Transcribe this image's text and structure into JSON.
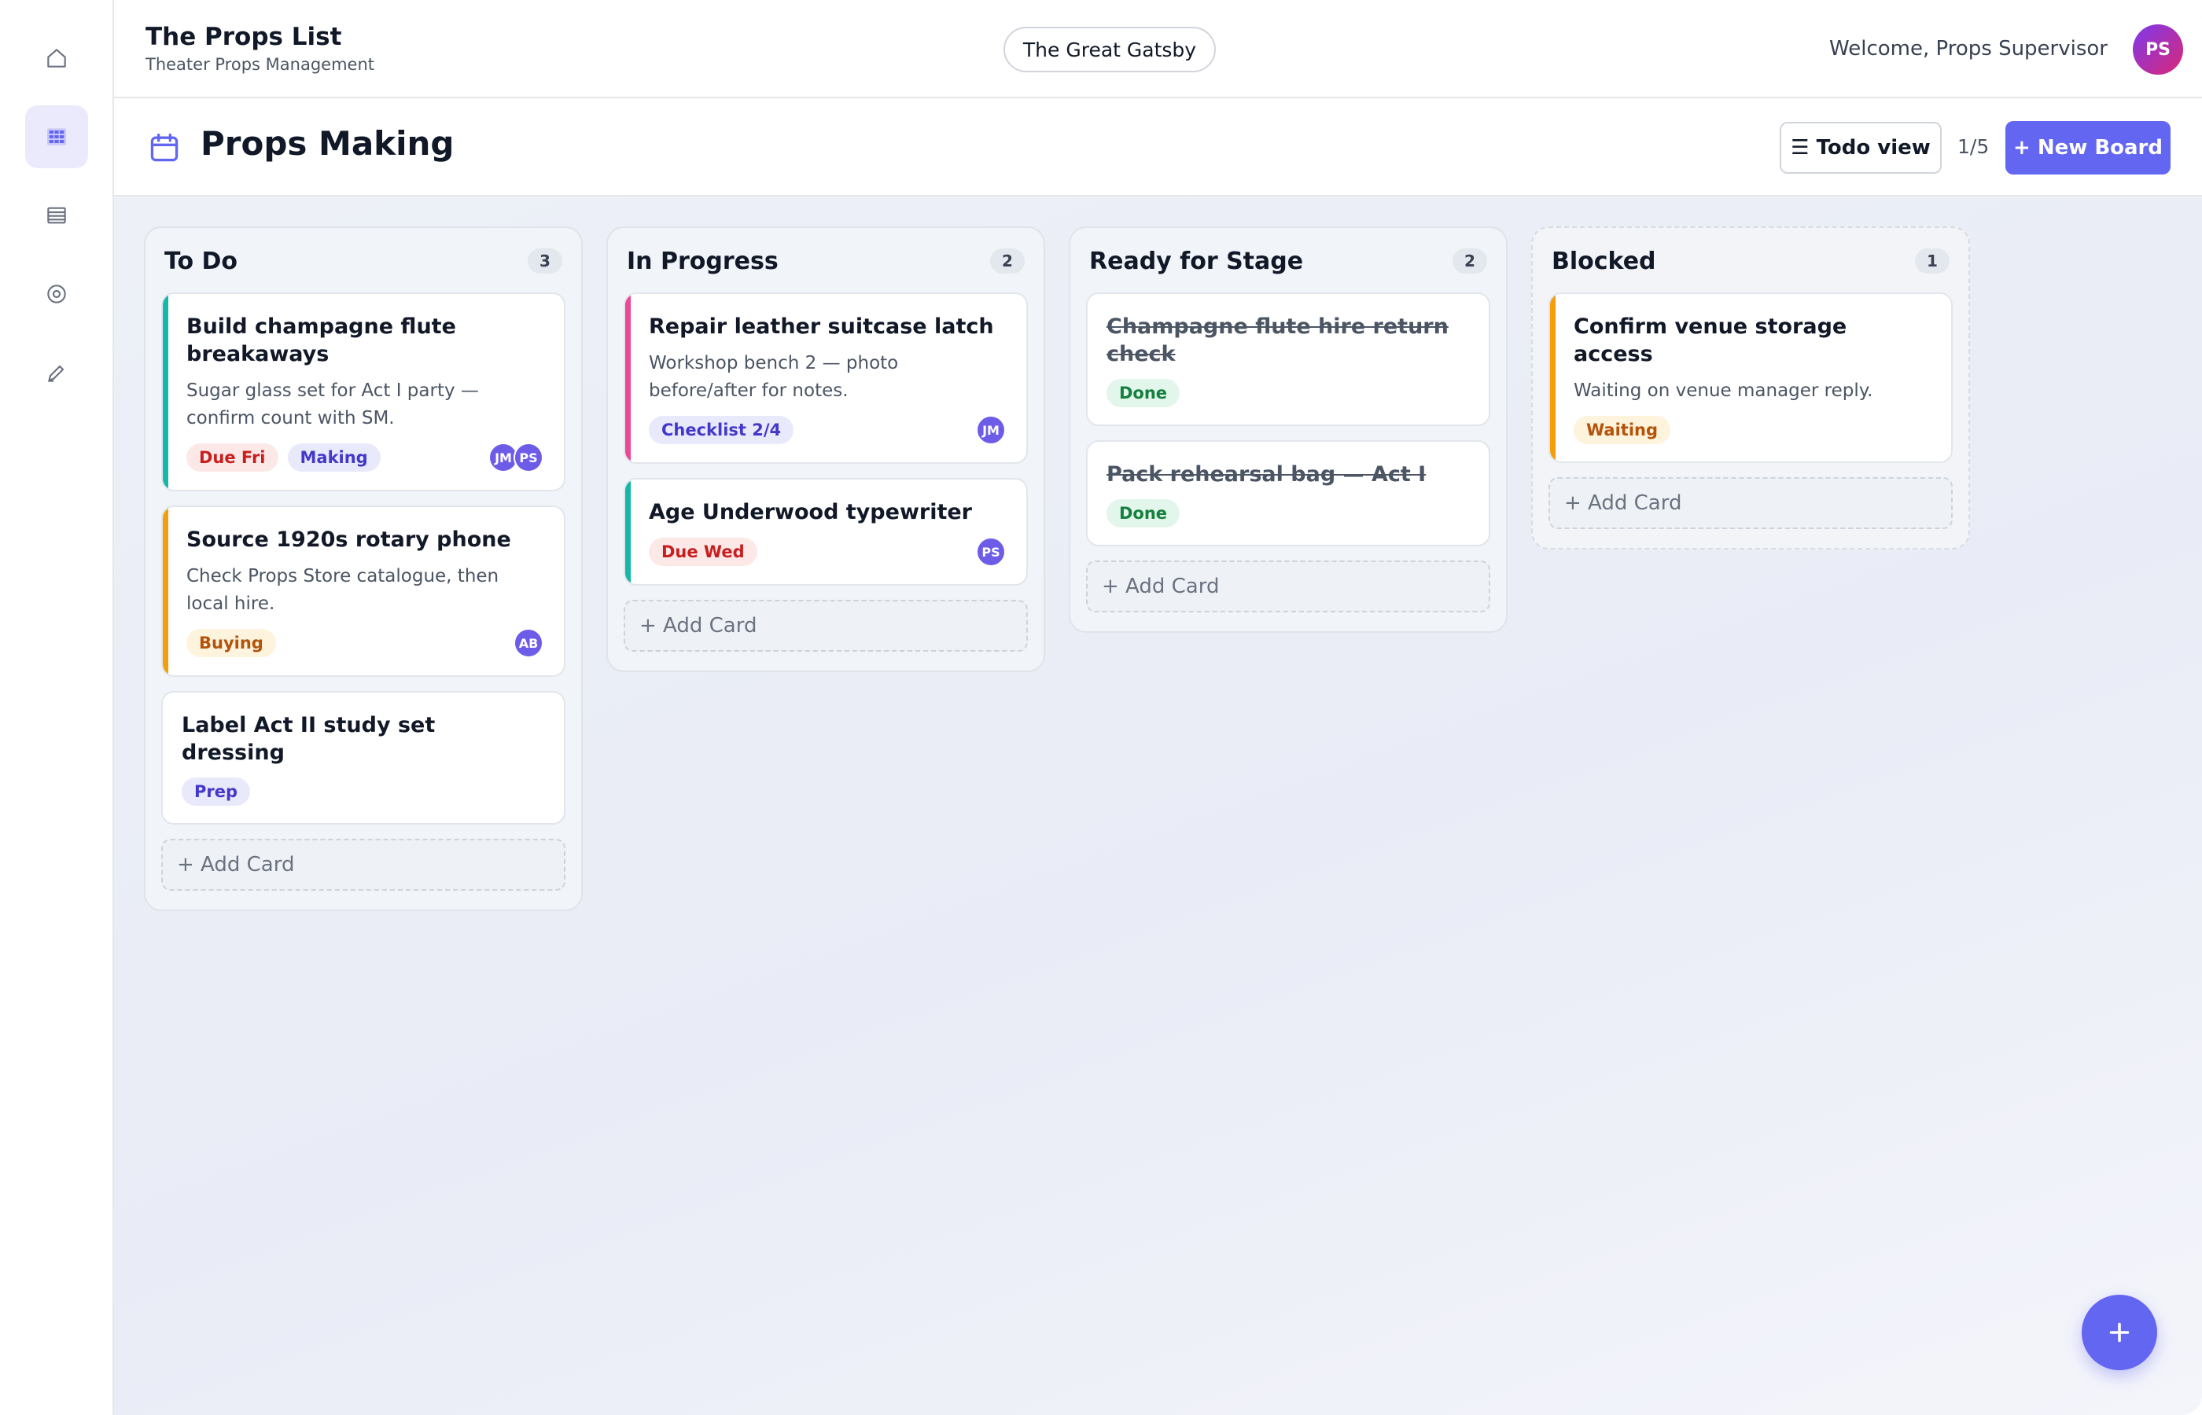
{
  "app": {
    "title": "The Props List",
    "subtitle": "Theater Props Management"
  },
  "show": {
    "name": "The Great Gatsby"
  },
  "user": {
    "welcome": "Welcome, Props Supervisor",
    "initials": "PS"
  },
  "sidebar": {
    "items": [
      {
        "icon": "home-icon",
        "glyph": "⌂"
      },
      {
        "icon": "board-grid-icon",
        "glyph": "▦",
        "active": true
      },
      {
        "icon": "list-icon",
        "glyph": "▤"
      },
      {
        "icon": "target-icon",
        "glyph": "◎"
      },
      {
        "icon": "pencil-icon",
        "glyph": "✎"
      }
    ]
  },
  "board": {
    "title": "Props Making",
    "view_button": "☰ Todo view",
    "page_count": "1/5",
    "new_board": "+ New Board"
  },
  "columns": [
    {
      "title": "To Do",
      "count": "3",
      "cards": [
        {
          "title": "Build champagne flute breakaways",
          "desc": "Sugar glass set for Act I party — confirm count with SM.",
          "accent": "#14b8a6",
          "tags": [
            {
              "label": "Due Fri",
              "bg": "#fde8e8",
              "fg": "#c81e1e"
            },
            {
              "label": "Making",
              "bg": "#e8e9fb",
              "fg": "#4338ca"
            }
          ],
          "avatars": [
            "JM",
            "PS"
          ]
        },
        {
          "title": "Source 1920s rotary phone",
          "desc": "Check Props Store catalogue, then local hire.",
          "accent": "#f59e0b",
          "tags": [
            {
              "label": "Buying",
              "bg": "#fef3dc",
              "fg": "#b45309"
            }
          ],
          "avatars": [
            "AB"
          ]
        },
        {
          "title": "Label Act II study set dressing",
          "desc": "",
          "accent": "",
          "tags": [
            {
              "label": "Prep",
              "bg": "#e8e9fb",
              "fg": "#4338ca"
            }
          ],
          "avatars": []
        }
      ],
      "add_label": "+ Add Card"
    },
    {
      "title": "In Progress",
      "count": "2",
      "cards": [
        {
          "title": "Repair leather suitcase latch",
          "desc": "Workshop bench 2 — photo before/after for notes.",
          "accent": "#ec4899",
          "tags": [
            {
              "label": "Checklist 2/4",
              "bg": "#e8e9fb",
              "fg": "#4338ca"
            }
          ],
          "avatars": [
            "JM"
          ]
        },
        {
          "title": "Age Underwood typewriter",
          "desc": "",
          "accent": "#14b8a6",
          "tags": [
            {
              "label": "Due Wed",
              "bg": "#fde8e8",
              "fg": "#c81e1e"
            }
          ],
          "avatars": [
            "PS"
          ]
        }
      ],
      "add_label": "+ Add Card"
    },
    {
      "title": "Ready for Stage",
      "count": "2",
      "cards": [
        {
          "title": "Champagne flute hire return check",
          "desc": "",
          "accent": "",
          "done": true,
          "tags": [
            {
              "label": "Done",
              "bg": "#e3f6ec",
              "fg": "#15803d"
            }
          ],
          "avatars": []
        },
        {
          "title": "Pack rehearsal bag — Act I",
          "desc": "",
          "accent": "",
          "done": true,
          "tags": [
            {
              "label": "Done",
              "bg": "#e3f6ec",
              "fg": "#15803d"
            }
          ],
          "avatars": []
        }
      ],
      "add_label": "+ Add Card"
    },
    {
      "title": "Blocked",
      "count": "1",
      "cards": [
        {
          "title": "Confirm venue storage access",
          "desc": "Waiting on venue manager reply.",
          "accent": "#f59e0b",
          "tags": [
            {
              "label": "Waiting",
              "bg": "#fef3dc",
              "fg": "#b45309"
            }
          ],
          "avatars": []
        }
      ],
      "add_label": "+ Add Card"
    }
  ],
  "fab": {
    "icon": "plus-icon",
    "glyph": "+"
  }
}
